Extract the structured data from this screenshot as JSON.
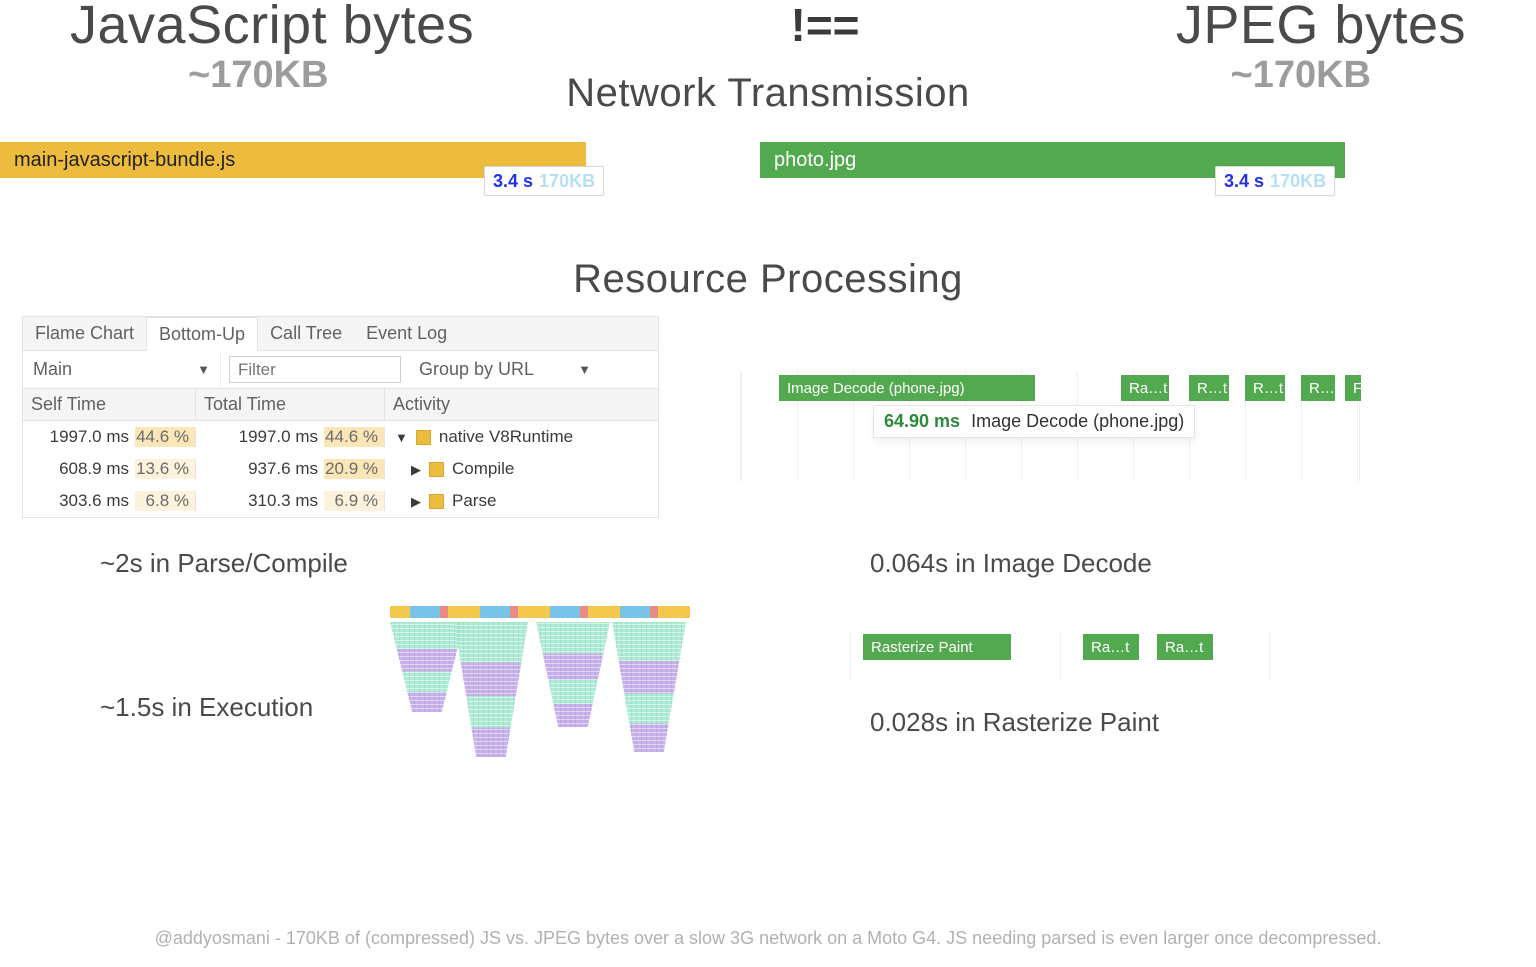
{
  "headings": {
    "left": "JavaScript bytes",
    "center": "!==",
    "right": "JPEG bytes"
  },
  "sizes": {
    "left": "~170KB",
    "right": "~170KB"
  },
  "sections": {
    "network": "Network Transmission",
    "resource": "Resource Processing"
  },
  "bars": {
    "js": {
      "label": "main-javascript-bundle.js",
      "time": "3.4 s",
      "size": "170KB"
    },
    "jpg": {
      "label": "photo.jpg",
      "time": "3.4 s",
      "size": "170KB"
    }
  },
  "devtools": {
    "tabs": [
      "Flame Chart",
      "Bottom-Up",
      "Call Tree",
      "Event Log"
    ],
    "active_tab": 1,
    "thread": "Main",
    "filter_placeholder": "Filter",
    "group_by": "Group by URL",
    "columns": [
      "Self Time",
      "Total Time",
      "Activity"
    ],
    "rows": [
      {
        "self_ms": "1997.0 ms",
        "self_pct": "44.6 %",
        "total_ms": "1997.0 ms",
        "total_pct": "44.6 %",
        "caret": "▼",
        "activity": "native V8Runtime",
        "indent": 0
      },
      {
        "self_ms": "608.9 ms",
        "self_pct": "13.6 %",
        "total_ms": "937.6 ms",
        "total_pct": "20.9 %",
        "caret": "▶",
        "activity": "Compile",
        "indent": 1
      },
      {
        "self_ms": "303.6 ms",
        "self_pct": "6.8 %",
        "total_ms": "310.3 ms",
        "total_pct": "6.9 %",
        "caret": "▶",
        "activity": "Parse",
        "indent": 1
      }
    ]
  },
  "image_decode": {
    "main_bar": "Image Decode (phone.jpg)",
    "small_bar": "Ra…t",
    "small_bar2": "R…t",
    "small_bar3": "R…t",
    "small_bar4": "R…",
    "small_bar5": "F",
    "tooltip_ms": "64.90 ms",
    "tooltip_label": "Image Decode (phone.jpg)"
  },
  "rasterize": {
    "main": "Rasterize Paint",
    "small": "Ra…t",
    "small2": "Ra…t"
  },
  "summaries": {
    "parse": "~2s in Parse/Compile",
    "decode": "0.064s in Image Decode",
    "exec": "~1.5s in Execution",
    "raster": "0.028s in Rasterize Paint"
  },
  "footer": "@addyosmani - 170KB of (compressed) JS vs. JPEG bytes over a slow 3G network on a Moto G4. JS needing parsed is even larger once decompressed."
}
